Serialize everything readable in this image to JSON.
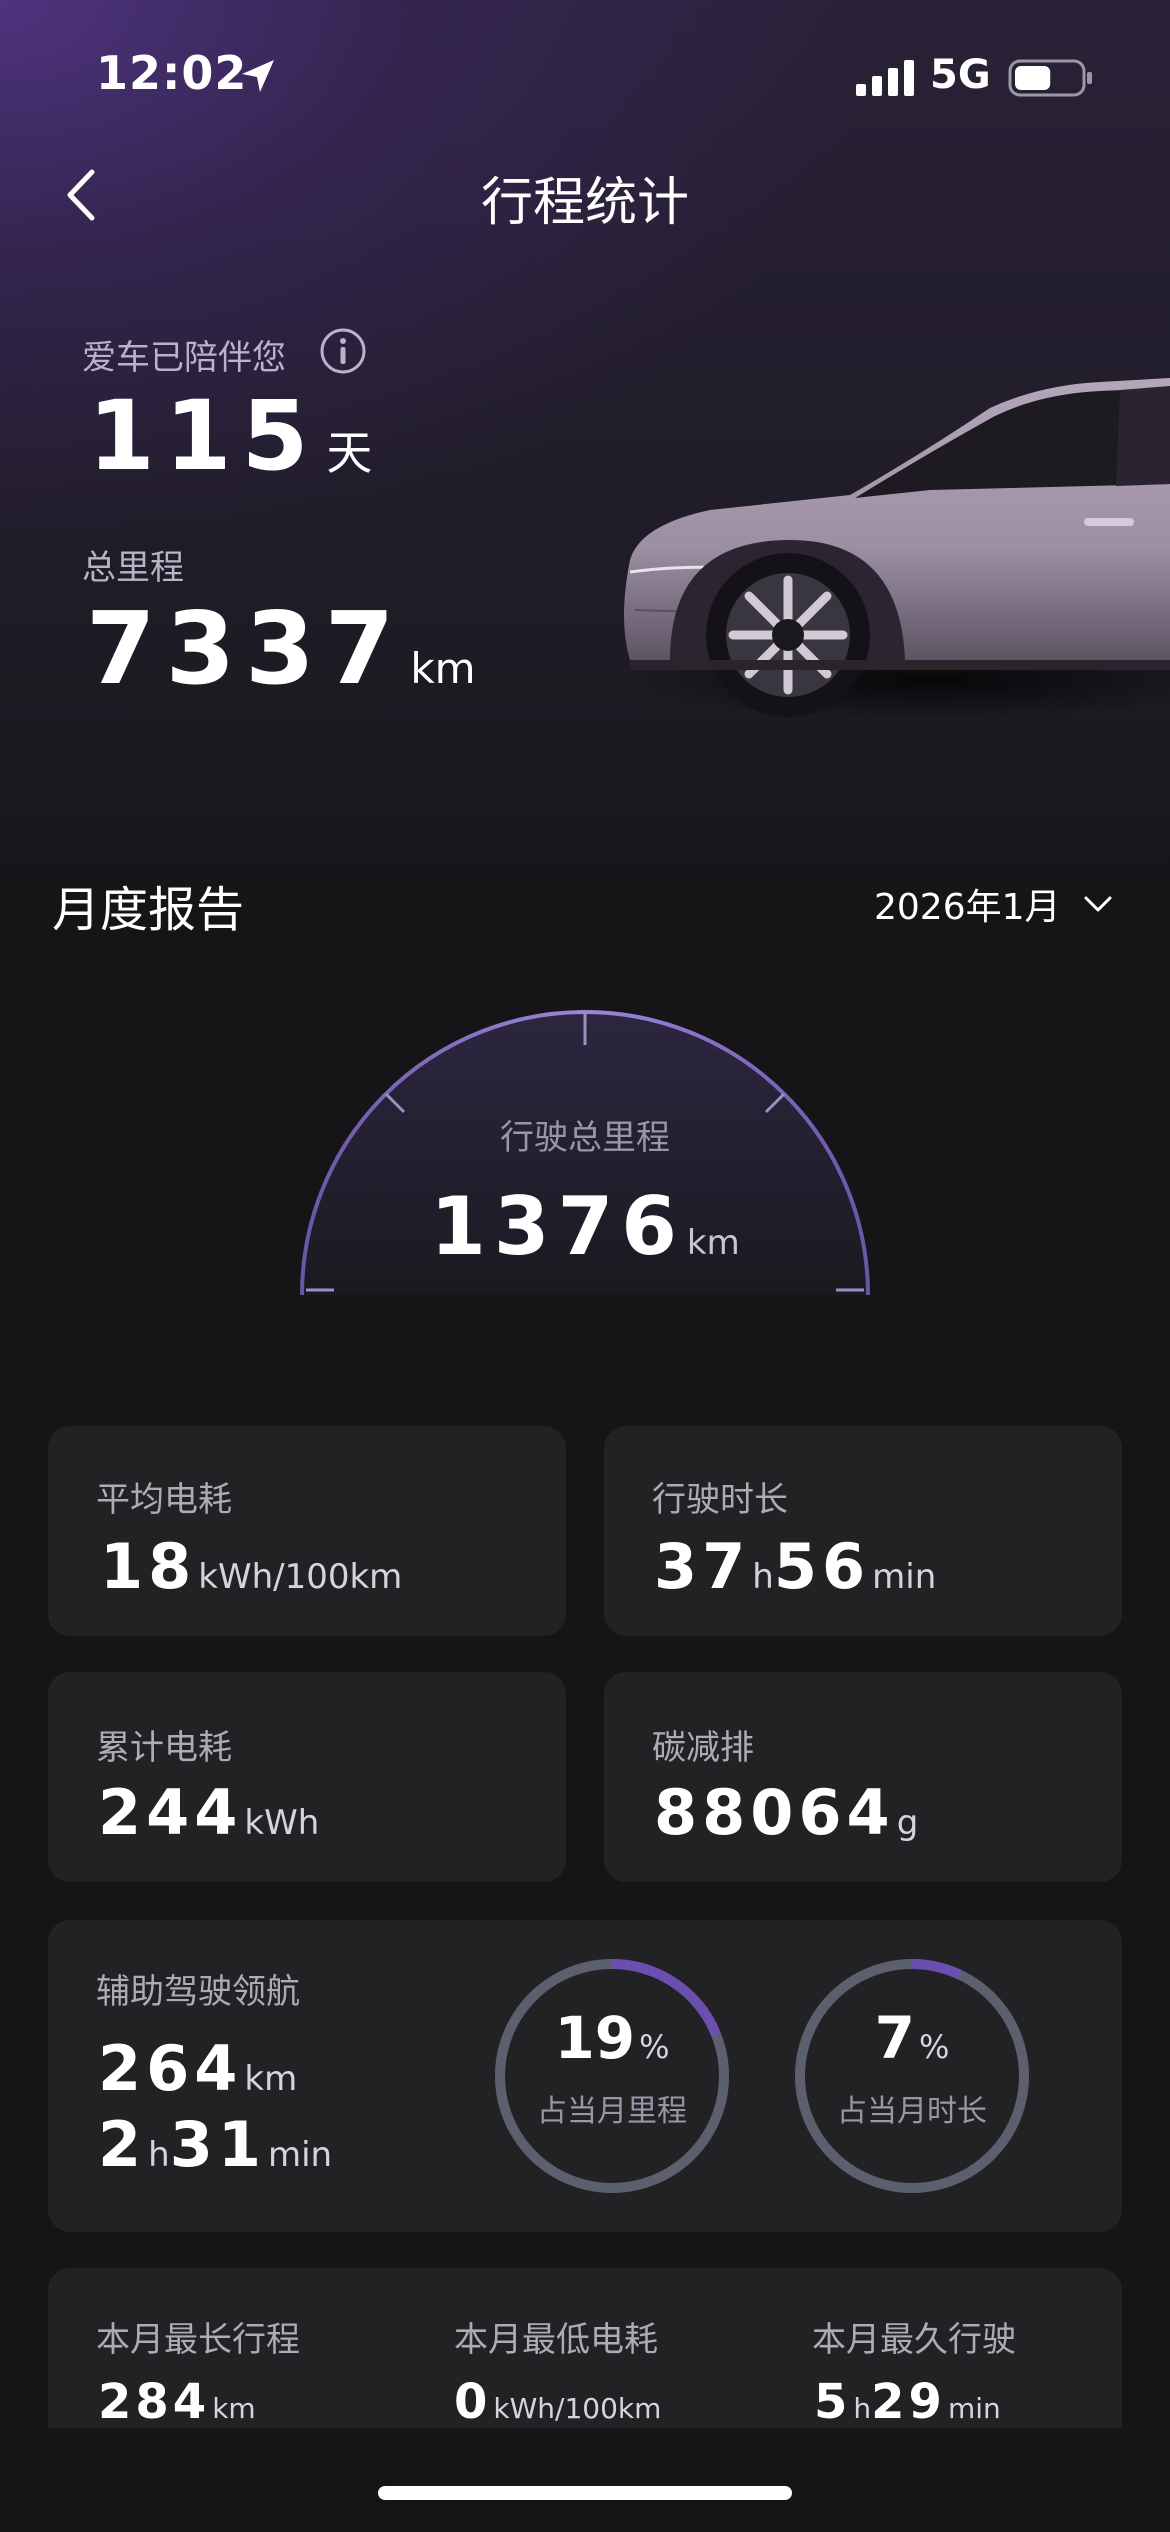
{
  "status_bar": {
    "time": "12:02",
    "network": "5G",
    "battery_level": 0.55
  },
  "nav": {
    "title": "行程统计"
  },
  "summary": {
    "companion_label": "爱车已陪伴您",
    "days": "115",
    "days_unit": "天",
    "mileage_label": "总里程",
    "mileage": "7337",
    "mileage_unit": "km"
  },
  "monthly": {
    "title": "月度报告",
    "month": "2026年1月",
    "gauge": {
      "label": "行驶总里程",
      "value": "1376",
      "unit": "km"
    },
    "stats": {
      "avg_consumption": {
        "label": "平均电耗",
        "value": "18",
        "unit": "kWh/100km"
      },
      "drive_duration": {
        "label": "行驶时长",
        "hours": "37",
        "h_unit": "h",
        "minutes": "56",
        "m_unit": "min"
      },
      "total_consumption": {
        "label": "累计电耗",
        "value": "244",
        "unit": "kWh"
      },
      "carbon_reduction": {
        "label": "碳减排",
        "value": "88064",
        "unit": "g"
      }
    },
    "assist": {
      "label": "辅助驾驶领航",
      "distance": "264",
      "distance_unit": "km",
      "hours": "2",
      "h_unit": "h",
      "minutes": "31",
      "m_unit": "min",
      "mileage_ratio": {
        "value": "19",
        "unit": "%",
        "caption": "占当月里程",
        "fraction": 0.19
      },
      "time_ratio": {
        "value": "7",
        "unit": "%",
        "caption": "占当月时长",
        "fraction": 0.07
      }
    },
    "records": {
      "longest_trip": {
        "label": "本月最长行程",
        "value": "284",
        "unit": "km"
      },
      "lowest_consumption": {
        "label": "本月最低电耗",
        "value": "0",
        "unit": "kWh/100km"
      },
      "longest_drive": {
        "label": "本月最久行驶",
        "hours": "5",
        "h_unit": "h",
        "minutes": "29",
        "m_unit": "min"
      }
    }
  },
  "colors": {
    "accent": "#6b4fb0",
    "ring_track": "#5c5f6e",
    "card_bg": "#222225"
  }
}
